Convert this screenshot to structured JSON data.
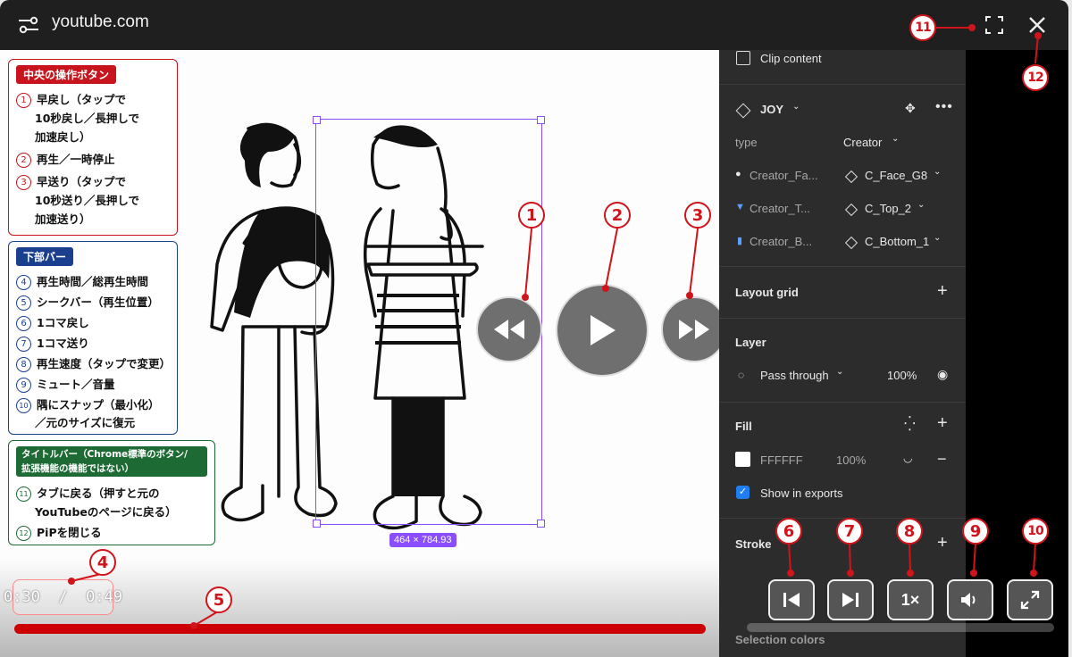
{
  "titlebar": {
    "domain": "youtube.com",
    "icons": [
      "settings-sliders-icon",
      "fullscreen-corners-icon",
      "close-icon"
    ]
  },
  "panel": {
    "clip_content": "Clip content",
    "component_name": "JOY",
    "type_label": "type",
    "type_value": "Creator",
    "props": [
      {
        "name": "Creator_Fa...",
        "value": "C_Face_G8"
      },
      {
        "name": "Creator_T...",
        "value": "C_Top_2"
      },
      {
        "name": "Creator_B...",
        "value": "C_Bottom_1"
      }
    ],
    "layout_grid": "Layout grid",
    "layer": "Layer",
    "blend_mode": "Pass through",
    "layer_opacity": "100%",
    "fill": "Fill",
    "fill_hex": "FFFFFF",
    "fill_opacity": "100%",
    "show_in_exports": "Show in exports",
    "stroke": "Stroke",
    "selection_colors": "Selection colors"
  },
  "canvas": {
    "dimension_badge": "464 × 784.93"
  },
  "player": {
    "time": "0:30  /  0:49",
    "progress_fraction": 0.61,
    "speed_label": "1×"
  },
  "legend_center": {
    "header": "中央の操作ボタン",
    "items": [
      {
        "num": "1",
        "text": "早戻し（タップで"
      },
      {
        "num": "",
        "text": "10秒戻し／長押しで"
      },
      {
        "num": "",
        "text": "加速戻し）"
      },
      {
        "num": "2",
        "text": "再生／一時停止"
      },
      {
        "num": "3",
        "text": "早送り（タップで"
      },
      {
        "num": "",
        "text": "10秒送り／長押しで"
      },
      {
        "num": "",
        "text": "加速送り）"
      }
    ]
  },
  "legend_bottom": {
    "header": "下部バー",
    "items": [
      {
        "num": "4",
        "text": "再生時間／総再生時間"
      },
      {
        "num": "5",
        "text": "シークバー（再生位置）"
      },
      {
        "num": "6",
        "text": "1コマ戻し"
      },
      {
        "num": "7",
        "text": "1コマ送り"
      },
      {
        "num": "8",
        "text": "再生速度（タップで変更）"
      },
      {
        "num": "9",
        "text": "ミュート／音量"
      },
      {
        "num": "10",
        "text": "隅にスナップ（最小化）"
      },
      {
        "num": "",
        "text": "／元のサイズに復元"
      }
    ]
  },
  "legend_title": {
    "header_line1": "タイトルバー（Chrome標準のボタン/",
    "header_line2": "拡張機能の機能ではない）",
    "items": [
      {
        "num": "11",
        "text": "タブに戻る（押すと元の"
      },
      {
        "num": "",
        "text": "YouTubeのページに戻る）"
      },
      {
        "num": "12",
        "text": "PiPを閉じる"
      }
    ]
  },
  "callouts": [
    "1",
    "2",
    "3",
    "4",
    "5",
    "6",
    "7",
    "8",
    "9",
    "10",
    "11",
    "12"
  ],
  "colors": {
    "callout_red": "#d0141b",
    "legend_center": "#c8141c",
    "legend_bottom": "#1a3f8f",
    "legend_title": "#1d6a34",
    "seek_red": "#cc0000",
    "selection_purple": "#8a4dff"
  }
}
